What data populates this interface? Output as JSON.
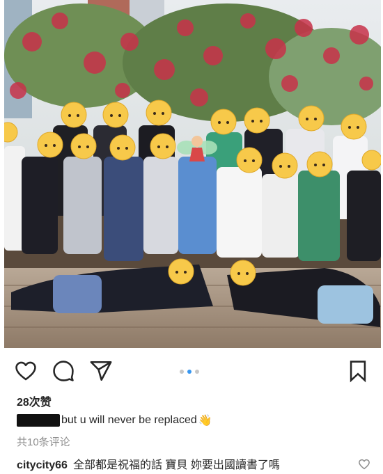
{
  "post": {
    "likes_text": "28次赞",
    "caption_text": "but u will never be replaced",
    "caption_emoji": "👋",
    "view_comments_text": "共10条评论",
    "comment": {
      "username": "citycity66",
      "text": "全部都是祝福的話 寶貝 妳要出國讀書了嗎"
    },
    "carousel": {
      "count": 3,
      "active_index": 1
    }
  },
  "icons": {
    "like": "heart-icon",
    "comment": "comment-icon",
    "share": "send-icon",
    "save": "bookmark-icon"
  },
  "colors": {
    "accent": "#3897f0",
    "muted": "#8e8e8e",
    "text": "#262626"
  }
}
